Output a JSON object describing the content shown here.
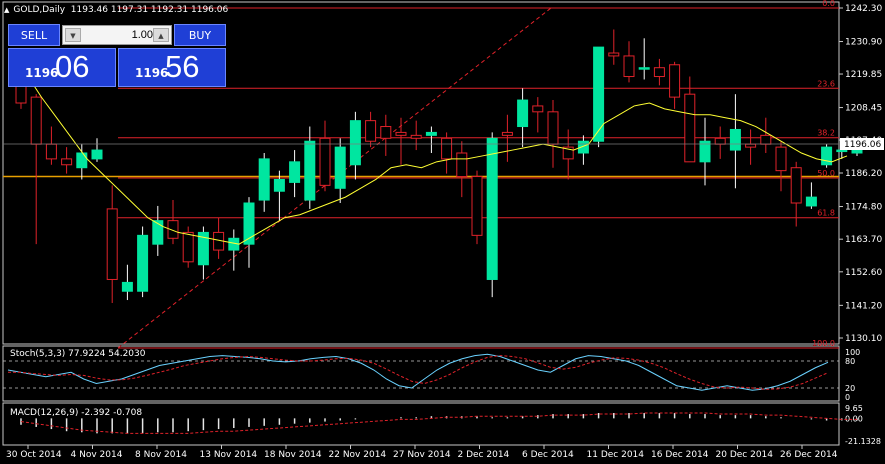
{
  "header": {
    "symbol": "GOLD,Daily",
    "ohlc": "1193.46 1197.31 1192.31 1196.06"
  },
  "trade_panel": {
    "sell_label": "SELL",
    "buy_label": "BUY",
    "lot_value": "1.00",
    "sell_price_prefix": "1196",
    "sell_price_main": "06",
    "buy_price_prefix": "1196",
    "buy_price_main": "56"
  },
  "colors": {
    "bull": "#00e6a0",
    "bear": "#000000",
    "bear_outline": "#e0222a",
    "level": "#e0222a",
    "ma": "#ffff33",
    "grid": "#c8c8c8",
    "stoch_main": "#6ad2ff",
    "stoch_signal": "#e0222a"
  },
  "chart_data": {
    "type": "candlestick",
    "price_ticks": [
      "1242.30",
      "1230.90",
      "1219.85",
      "1208.45",
      "1197.40",
      "1186.20",
      "1174.80",
      "1163.70",
      "1152.60",
      "1141.20",
      "1130.10"
    ],
    "current_price": "1196.06",
    "date_labels": [
      "30 Oct 2014",
      "4 Nov 2014",
      "8 Nov 2014",
      "13 Nov 2014",
      "18 Nov 2014",
      "22 Nov 2014",
      "27 Nov 2014",
      "2 Dec 2014",
      "6 Dec 2014",
      "11 Dec 2014",
      "16 Dec 2014",
      "20 Dec 2014",
      "26 Dec 2014"
    ],
    "fibo_levels": [
      {
        "label": "0.0",
        "price": 1242.3
      },
      {
        "label": "23.6",
        "price": 1215.0
      },
      {
        "label": "38.2",
        "price": 1198.2
      },
      {
        "label": "50.0",
        "price": 1184.5
      },
      {
        "label": "61.8",
        "price": 1171.0
      },
      {
        "label": "100.0",
        "price": 1126.7
      }
    ],
    "horizontal_line_price": 1185.0,
    "candles": [
      [
        1220,
        1222,
        1208,
        1210
      ],
      [
        1212,
        1213,
        1162,
        1196
      ],
      [
        1196,
        1202,
        1189,
        1191
      ],
      [
        1191,
        1195,
        1186,
        1189
      ],
      [
        1188,
        1196,
        1184,
        1193
      ],
      [
        1191,
        1198,
        1190,
        1194
      ],
      [
        1174,
        1182,
        1142,
        1150
      ],
      [
        1146,
        1155,
        1143,
        1149
      ],
      [
        1146,
        1168,
        1144,
        1165
      ],
      [
        1162,
        1175,
        1158,
        1170
      ],
      [
        1170,
        1177,
        1162,
        1164
      ],
      [
        1166,
        1168,
        1154,
        1156
      ],
      [
        1155,
        1168,
        1150,
        1166
      ],
      [
        1166,
        1171,
        1157,
        1160
      ],
      [
        1160,
        1167,
        1153,
        1164
      ],
      [
        1162,
        1178,
        1154,
        1176
      ],
      [
        1177,
        1193,
        1173,
        1191
      ],
      [
        1180,
        1187,
        1170,
        1184
      ],
      [
        1183,
        1194,
        1178,
        1190
      ],
      [
        1177,
        1202,
        1174,
        1197
      ],
      [
        1198,
        1204,
        1180,
        1182
      ],
      [
        1181,
        1198,
        1176,
        1195
      ],
      [
        1189,
        1207,
        1184,
        1204
      ],
      [
        1204,
        1207,
        1195,
        1197
      ],
      [
        1202,
        1206,
        1192,
        1198
      ],
      [
        1200,
        1205,
        1189,
        1199
      ],
      [
        1199,
        1204,
        1194,
        1198
      ],
      [
        1199,
        1202,
        1193,
        1200
      ],
      [
        1198,
        1200,
        1186,
        1191
      ],
      [
        1193,
        1197,
        1178,
        1185
      ],
      [
        1185,
        1187,
        1162,
        1165
      ],
      [
        1150,
        1200,
        1144,
        1198
      ],
      [
        1200,
        1206,
        1190,
        1199
      ],
      [
        1202,
        1215,
        1195,
        1211
      ],
      [
        1209,
        1212,
        1200,
        1207
      ],
      [
        1207,
        1211,
        1188,
        1196
      ],
      [
        1195,
        1201,
        1184,
        1191
      ],
      [
        1193,
        1199,
        1189,
        1197
      ],
      [
        1197,
        1228,
        1195,
        1229
      ],
      [
        1227,
        1235,
        1223,
        1226
      ],
      [
        1226,
        1231,
        1217,
        1219
      ],
      [
        1222,
        1232,
        1218,
        1222
      ],
      [
        1222,
        1225,
        1216,
        1219
      ],
      [
        1223,
        1224,
        1208,
        1212
      ],
      [
        1213,
        1219,
        1192,
        1190
      ],
      [
        1190,
        1205,
        1182,
        1197
      ],
      [
        1198,
        1202,
        1191,
        1196
      ],
      [
        1194,
        1213,
        1181,
        1201
      ],
      [
        1196,
        1201,
        1189,
        1195
      ],
      [
        1199,
        1205,
        1193,
        1196
      ],
      [
        1195,
        1197,
        1180,
        1187
      ],
      [
        1188,
        1190,
        1168,
        1176
      ],
      [
        1175,
        1183,
        1174,
        1178
      ],
      [
        1189,
        1196,
        1188,
        1195
      ],
      [
        1194,
        1196,
        1191,
        1194
      ],
      [
        1193,
        1197,
        1192,
        1196
      ]
    ],
    "ma_line": [
      1225,
      1220,
      1212,
      1205,
      1198,
      1191,
      1186,
      1181,
      1176,
      1171,
      1168,
      1166,
      1165,
      1164,
      1163,
      1162,
      1165,
      1168,
      1171,
      1172,
      1174,
      1176,
      1178,
      1181,
      1184,
      1188,
      1189,
      1188,
      1190,
      1191,
      1191,
      1192,
      1193,
      1194,
      1195,
      1196,
      1195,
      1194,
      1196,
      1203,
      1206,
      1209,
      1210,
      1208,
      1207,
      1206,
      1206,
      1205,
      1204,
      1202,
      1199,
      1196,
      1193,
      1191,
      1190,
      1192
    ],
    "stochastic": {
      "label": "Stoch(5,3,3) 77.9224 54.2030",
      "scale": [
        "100",
        "80",
        "20",
        "0"
      ],
      "main": [
        60,
        55,
        50,
        45,
        50,
        55,
        40,
        30,
        35,
        40,
        50,
        60,
        70,
        75,
        80,
        85,
        90,
        92,
        90,
        88,
        85,
        80,
        78,
        80,
        85,
        88,
        90,
        85,
        75,
        60,
        40,
        25,
        20,
        40,
        60,
        75,
        85,
        92,
        95,
        90,
        80,
        70,
        60,
        55,
        70,
        85,
        92,
        90,
        85,
        80,
        70,
        55,
        40,
        25,
        20,
        15,
        20,
        25,
        20,
        15,
        18,
        25,
        35,
        50,
        65,
        77
      ],
      "signal": [
        55,
        55,
        52,
        50,
        48,
        50,
        48,
        42,
        38,
        38,
        42,
        48,
        55,
        62,
        70,
        75,
        80,
        85,
        88,
        90,
        88,
        85,
        82,
        80,
        80,
        82,
        85,
        86,
        82,
        75,
        62,
        48,
        35,
        30,
        38,
        50,
        65,
        78,
        88,
        92,
        90,
        85,
        76,
        66,
        62,
        66,
        75,
        82,
        87,
        86,
        82,
        75,
        65,
        52,
        40,
        30,
        22,
        20,
        22,
        20,
        17,
        18,
        22,
        30,
        42,
        54
      ]
    },
    "macd": {
      "label": "MACD(12,26,9) -2.392 -0.708",
      "scale": [
        "9.65",
        "0.00",
        "-21.1328"
      ],
      "histogram": [
        -6,
        -8,
        -10,
        -12,
        -13,
        -14,
        -14,
        -14,
        -14,
        -13,
        -13,
        -12,
        -11,
        -10,
        -9,
        -8,
        -7,
        -6,
        -5,
        -4,
        -3,
        -2,
        -1,
        0,
        0,
        1,
        1,
        2,
        2,
        2,
        2,
        1,
        1,
        2,
        3,
        4,
        4,
        4,
        5,
        5,
        5,
        5,
        5,
        5,
        4,
        4,
        3,
        3,
        3,
        2,
        1,
        0,
        -1,
        -2,
        -2,
        -2
      ],
      "signal": [
        -3,
        -5,
        -7,
        -9,
        -11,
        -12,
        -13,
        -14,
        -14,
        -14,
        -14,
        -14,
        -13,
        -12,
        -12,
        -11,
        -10,
        -9,
        -8,
        -7,
        -6,
        -5,
        -4,
        -3,
        -2,
        -1,
        -1,
        0,
        1,
        1,
        2,
        2,
        2,
        2,
        2,
        3,
        3,
        3,
        4,
        4,
        4,
        5,
        5,
        5,
        5,
        5,
        4,
        4,
        4,
        3,
        3,
        2,
        1,
        0,
        -1,
        -1
      ]
    }
  }
}
